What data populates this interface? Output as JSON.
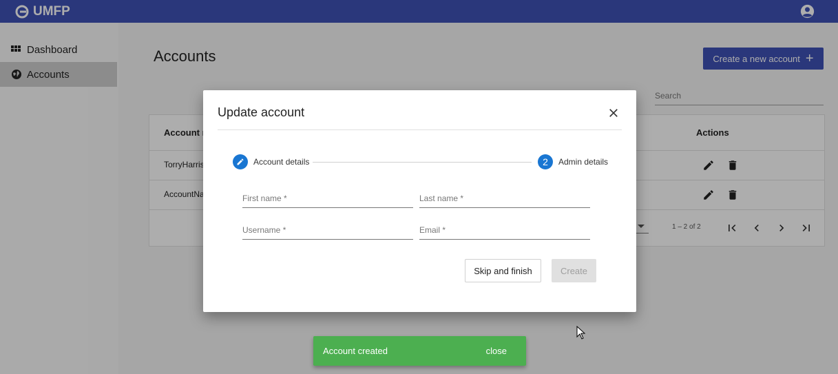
{
  "app": {
    "brand": "UMFP"
  },
  "sidebar": {
    "items": [
      {
        "label": "Dashboard",
        "icon": "grid-icon"
      },
      {
        "label": "Accounts",
        "icon": "globe-icon"
      }
    ]
  },
  "main": {
    "title": "Accounts",
    "create_button": "Create a new account",
    "search_placeholder": "Search",
    "table": {
      "columns": [
        "Account n",
        "Actions"
      ],
      "rows": [
        {
          "name": "TorryHarris"
        },
        {
          "name": "AccountNa"
        }
      ],
      "range_label": "1 – 2 of 2"
    }
  },
  "dialog": {
    "title": "Update account",
    "steps": [
      {
        "label": "Account details",
        "state": "edit"
      },
      {
        "label": "Admin details",
        "number": "2"
      }
    ],
    "fields": {
      "first_name": "First name *",
      "last_name": "Last name *",
      "username": "Username *",
      "email": "Email *"
    },
    "skip_button": "Skip and finish",
    "create_button": "Create"
  },
  "snackbar": {
    "message": "Account created",
    "action": "close"
  },
  "colors": {
    "primary": "#3f51b5",
    "step": "#1976d2",
    "snackbar": "#4caf50"
  }
}
